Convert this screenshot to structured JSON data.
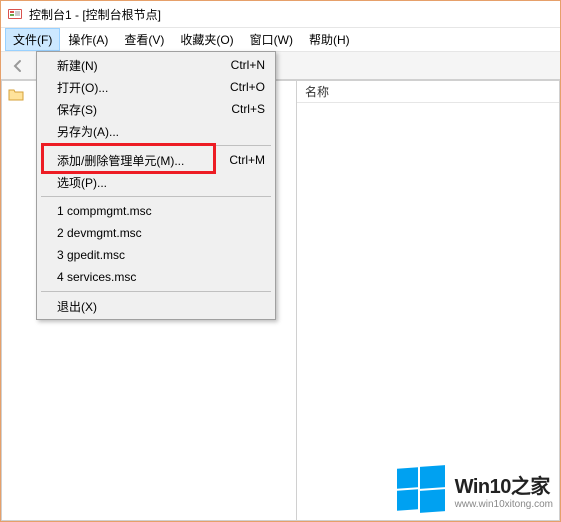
{
  "titlebar": {
    "text": "控制台1 - [控制台根节点]"
  },
  "menubar": {
    "items": [
      {
        "label": "文件(F)"
      },
      {
        "label": "操作(A)"
      },
      {
        "label": "查看(V)"
      },
      {
        "label": "收藏夹(O)"
      },
      {
        "label": "窗口(W)"
      },
      {
        "label": "帮助(H)"
      }
    ]
  },
  "dropdown": {
    "new": {
      "label": "新建(N)",
      "shortcut": "Ctrl+N"
    },
    "open": {
      "label": "打开(O)...",
      "shortcut": "Ctrl+O"
    },
    "save": {
      "label": "保存(S)",
      "shortcut": "Ctrl+S"
    },
    "saveas": {
      "label": "另存为(A)..."
    },
    "snapin": {
      "label": "添加/删除管理单元(M)...",
      "shortcut": "Ctrl+M"
    },
    "options": {
      "label": "选项(P)..."
    },
    "recent1": {
      "label": "1 compmgmt.msc"
    },
    "recent2": {
      "label": "2 devmgmt.msc"
    },
    "recent3": {
      "label": "3 gpedit.msc"
    },
    "recent4": {
      "label": "4 services.msc"
    },
    "exit": {
      "label": "退出(X)"
    }
  },
  "list": {
    "column_name": "名称"
  },
  "watermark": {
    "title": "Win10之家",
    "url": "www.win10xitong.com"
  }
}
